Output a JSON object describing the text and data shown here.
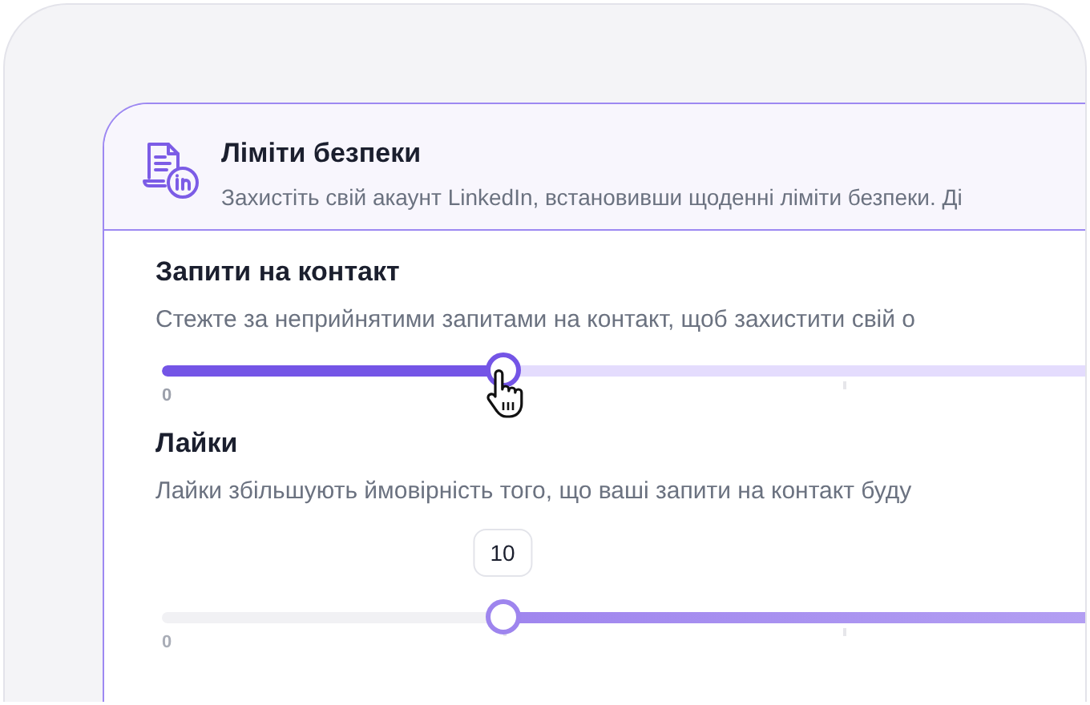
{
  "card": {
    "title": "Ліміти безпеки",
    "description": "Захистіть свій акаунт LinkedIn, встановивши щоденні ліміти безпеки. Ді"
  },
  "settings": [
    {
      "title": "Запити на контакт",
      "description": "Стежте за неприйнятими запитами на контакт, щоб захистити свій о",
      "slider": {
        "kind": "lower",
        "level": 0.25,
        "min_label": "0",
        "pointer": true
      }
    },
    {
      "title": "Лайки",
      "description": "Лайки збільшують ймовірність того, що ваші запити на контакт буду",
      "slider": {
        "kind": "upper",
        "min_label": "0",
        "value_label": "10"
      }
    }
  ]
}
